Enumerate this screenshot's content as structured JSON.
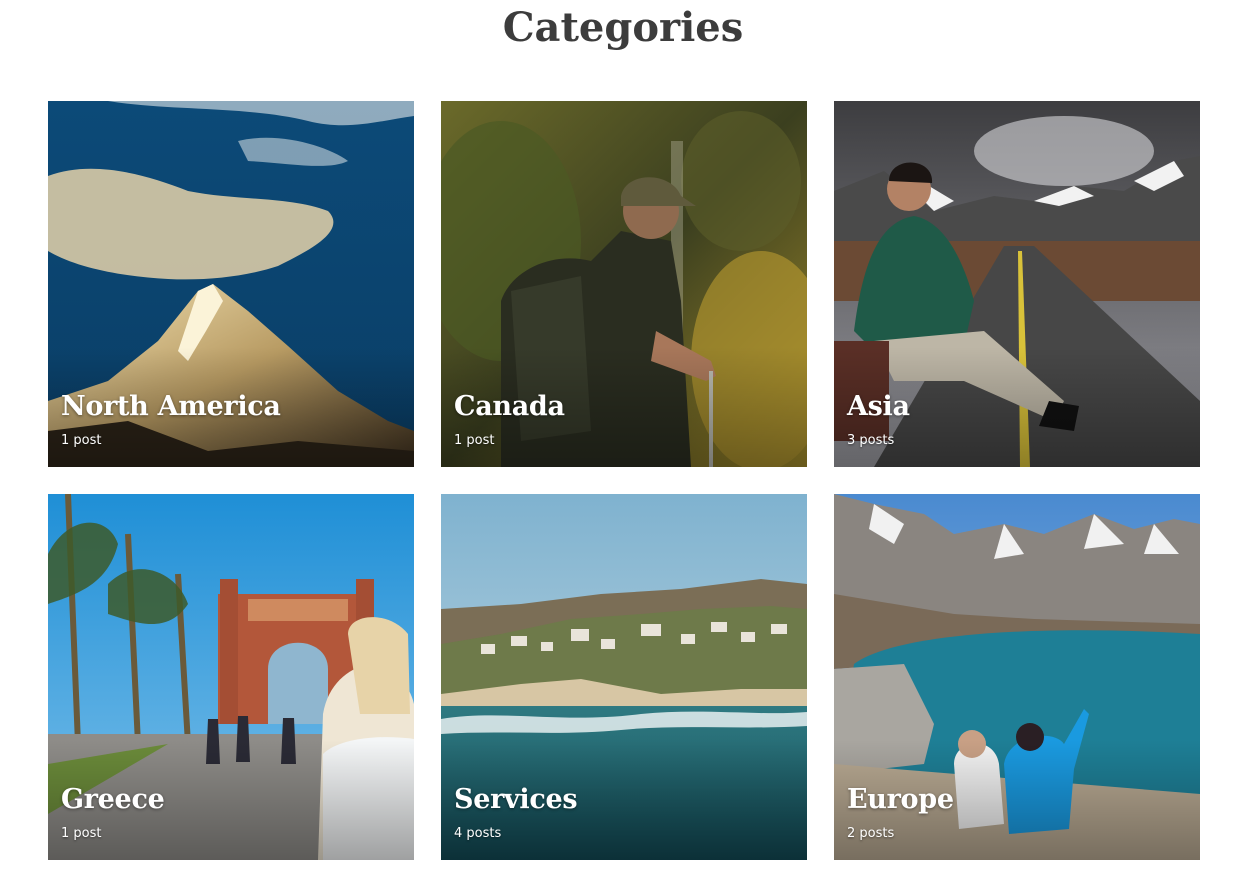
{
  "page": {
    "title": "Categories"
  },
  "categories": [
    {
      "name": "North America",
      "count": "1 post"
    },
    {
      "name": "Canada",
      "count": "1 post"
    },
    {
      "name": "Asia",
      "count": "3 posts"
    },
    {
      "name": "Greece",
      "count": "1 post"
    },
    {
      "name": "Services",
      "count": "4 posts"
    },
    {
      "name": "Europe",
      "count": "2 posts"
    }
  ]
}
